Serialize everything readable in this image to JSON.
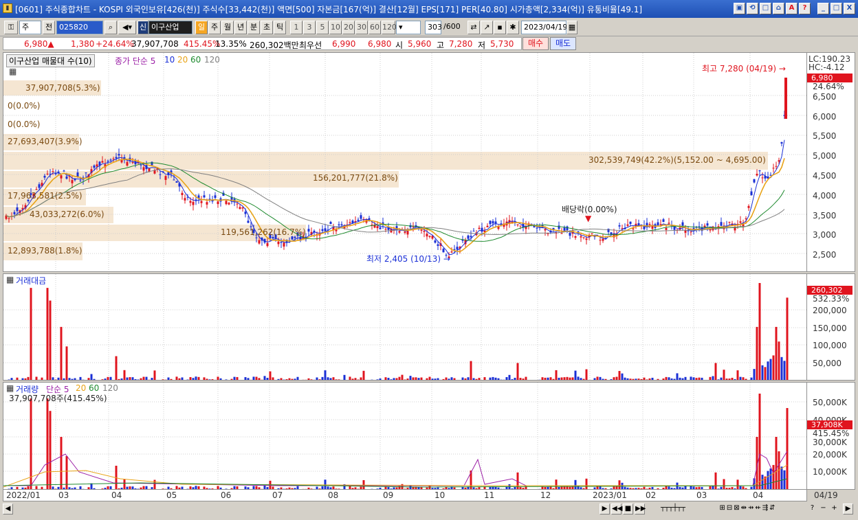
{
  "window": {
    "title": "[0601] 주식종합차트 - KOSPI 외국인보유[426(천)] 주식수[33,442(천)] 액면[500] 자본금[167(억)] 결산[12월] EPS[171] PER[40.80] 시가총액[2,334(억)] 유통비율[49.1]",
    "buttons": [
      "▣",
      "⟲",
      "□",
      "⌂",
      "A",
      "?",
      "_",
      "□",
      "X"
    ]
  },
  "toolbar": {
    "period_select": "주",
    "prev_label": "전",
    "code": "025820",
    "stock_badge": "신",
    "stock_name": "이구산업",
    "periods": [
      "일",
      "주",
      "월",
      "년",
      "분",
      "초",
      "틱"
    ],
    "active_period": "일",
    "intervals": [
      "1",
      "3",
      "5",
      "10",
      "20",
      "30",
      "60",
      "120"
    ],
    "count": "303",
    "count_total": "/600",
    "date": "2023/04/19"
  },
  "pricebar": {
    "price": "6,980▲",
    "change": "1,380",
    "change_pct": "+24.64%",
    "volume": "37,907,708",
    "volume_ratio": "415.45%",
    "turnover": "13.35%",
    "amount": "260,302백만",
    "best_offer_label": "최우선",
    "ask": "6,990",
    "bid": "6,980",
    "open_label": "시",
    "open": "5,960",
    "high_label": "고",
    "high": "7,280",
    "low_label": "저",
    "low": "5,730",
    "buy_label": "매수",
    "sell_label": "매도"
  },
  "price_panel": {
    "title": "이구산업 매물대 수(10)",
    "ma_label": "종가 단순 5",
    "ma_periods": [
      "10",
      "20",
      "60",
      "120"
    ],
    "ma_colors": [
      "#1a2fd6",
      "#e8a317",
      "#1e8a2e",
      "#808080"
    ],
    "volume_profile": [
      "37,907,708(5.3%)",
      "0(0.0%)",
      "0(0.0%)",
      "27,693,407(3.9%)",
      "156,201,777(21.8%)",
      "302,539,749(42.2%)(5,152.00 ~ 4,695.00)",
      "17,963,581(2.5%)",
      "43,033,272(6.0%)",
      "119,561,262(16.7%)",
      "12,893,788(1.8%)"
    ],
    "high_annotation": "최고 7,280 (04/19) →",
    "low_annotation": "최저 2,405 (10/13) →",
    "dividend_annotation": "배당락(0.00%)",
    "axis": {
      "lc": "LC:190.23",
      "hc": "HC:-4.12",
      "current": "6,980",
      "current_pct": "24.64%",
      "ticks": [
        "6,500",
        "6,000",
        "5,500",
        "5,000",
        "4,500",
        "4,000",
        "3,500",
        "3,000",
        "2,500"
      ]
    }
  },
  "amount_panel": {
    "title": "거래대금",
    "current": "260,302",
    "current_pct": "532.33%",
    "ticks": [
      "200,000",
      "150,000",
      "100,000",
      "50,000"
    ]
  },
  "volume_panel": {
    "title": "거래량",
    "ma_label": "단순 5",
    "ma_periods": [
      "20",
      "60",
      "120"
    ],
    "sub": "37,907,708주(415.45%)",
    "current": "37,908K",
    "current_pct": "415.45%",
    "ticks": [
      "50,000K",
      "40,000K",
      "30,000K",
      "20,000K",
      "10,000K"
    ]
  },
  "dates": [
    "2022/01",
    "03",
    "04",
    "05",
    "06",
    "07",
    "08",
    "09",
    "10",
    "11",
    "12",
    "2023/01",
    "02",
    "03",
    "04"
  ],
  "date_right": "04/19",
  "colors": {
    "up": "#e0141e",
    "down": "#1a2fd6",
    "band": "#f5e6d2"
  }
}
